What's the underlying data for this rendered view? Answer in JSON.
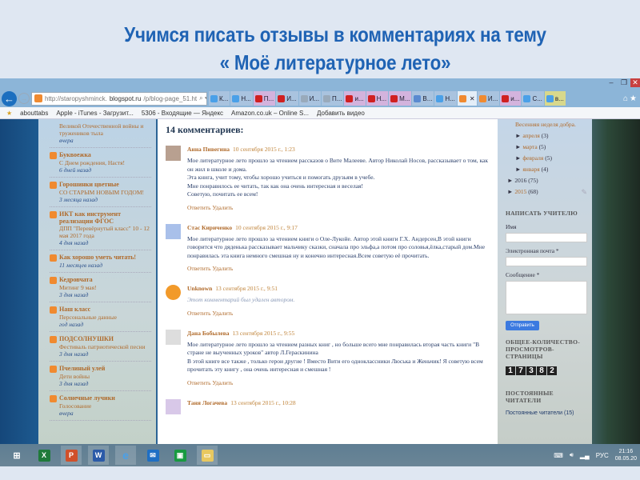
{
  "slide": {
    "title_line1": "Учимся писать отзывы в комментариях на тему",
    "title_line2": "« Моё литературное лето»"
  },
  "browser": {
    "url_host": "http://staropyshminck.",
    "url_domain": "blogspot.ru",
    "url_path": "/p/blog-page_51.ht",
    "tabs": [
      "К...",
      "Н...",
      "П...",
      "И...",
      "И...",
      "П...",
      "и...",
      "Н...",
      "М...",
      "В...",
      "Н...",
      "",
      "И...",
      "и...",
      "С...",
      "в..."
    ],
    "favorites": [
      "abouttabs",
      "Apple - iTunes - Загрузит...",
      "5306 - Входящие — Яндекс",
      "Amazon.co.uk – Online S...",
      "Добавить видео"
    ]
  },
  "left_sidebar": {
    "blogs": [
      {
        "name": "",
        "post": "Великой Отечественной войны и тружеников тыла",
        "when": "вчера"
      },
      {
        "name": "Буквоежка",
        "post": "С Днем рождения, Настя!",
        "when": "6 дней назад"
      },
      {
        "name": "Горошинки цветные",
        "post": "СО СТАРЫМ НОВЫМ ГОДОМ!",
        "when": "3 месяца назад"
      },
      {
        "name": "ИКТ как инструмент реализации ФГОС",
        "post": "ДПП \"Перевёрнутый класс\" 10 - 12 мая 2017 года",
        "when": "4 дня назад"
      },
      {
        "name": "Как хорошо уметь читать!",
        "post": "",
        "when": "11 месяцев назад"
      },
      {
        "name": "Кедровчата",
        "post": "Митинг 9 мая!",
        "when": "3 дня назад"
      },
      {
        "name": "Наш класс",
        "post": "Персональные данные",
        "when": "год назад"
      },
      {
        "name": "ПОДСОЛНУШКИ",
        "post": "Фестиваль патриотической песни",
        "when": "3 дня назад"
      },
      {
        "name": "Пчелиный улей",
        "post": "Дети войны",
        "when": "3 дня назад"
      },
      {
        "name": "Солнечные лучики",
        "post": "Голосование",
        "when": "вчера"
      }
    ]
  },
  "comments": {
    "count_label": "14 комментариев:",
    "reply": "Ответить",
    "delete": "Удалить",
    "items": [
      {
        "author": "Анна Пивегина",
        "date": "10 сентября 2015 г., 1:23",
        "text": "Мое литературное лето прошло за чтением рассказов о Вите Малееве. Автор Николай Носов, рассказывает о том, как он жил в школе и дома.\nЭта книга, учит тому, чтобы хорошо учиться и помогать друзьям в учебе.\nМне понравилось ее читать, так как она очень интересная и веселая!\nСоветую, почитать ее всем!"
      },
      {
        "author": "Стас Кириченко",
        "date": "10 сентября 2015 г., 9:17",
        "text": "Мое литературное лето прошло за чтением книги о Оле-Лукойе. Автор этой книги Г.Х. Андерсен,В этой книги говорится что дяденька рассказывает мальчику сказки, сначала про эльфа,а потом про соловья,ёлка,старый дом.Мне понравилась эта книга немного смешная ну и конечно интересная.Всем советую её прочитать."
      },
      {
        "author": "Unknown",
        "date": "13 сентября 2015 г., 9:51",
        "text": "Этот комментарий был удален автором."
      },
      {
        "author": "Дана Бобылева",
        "date": "13 сентября 2015 г., 9:55",
        "text": "Мое литературное лето прошло за чтением разных книг , но больше всего мне понравилась вторая часть книги \"В стране не выученных уроков\" автор Л.Гераскинина\nВ этой книге все также , только герои другие ! Вместо Вити его одноклассники Люська и Женьчик! Я советую всем прочитать эту книгу , она очень интересная и смешная !"
      },
      {
        "author": "Таня Логачева",
        "date": "13 сентября 2015 г., 10:28",
        "text": ""
      }
    ]
  },
  "right_sidebar": {
    "top_post": "Весенняя неделя добра.",
    "months": [
      {
        "m": "апреля",
        "c": "(3)"
      },
      {
        "m": "марта",
        "c": "(5)"
      },
      {
        "m": "февраля",
        "c": "(5)"
      },
      {
        "m": "января",
        "c": "(4)"
      }
    ],
    "years": [
      {
        "y": "2016",
        "c": "(75)"
      },
      {
        "y": "2015",
        "c": "(68)"
      }
    ],
    "contact_title": "НАПИСАТЬ УЧИТЕЛЮ",
    "name_label": "Имя",
    "email_label": "Электронная почта *",
    "message_label": "Сообщение *",
    "send": "Отправить",
    "views_title": "ОБЩЕЕ-КОЛИЧЕСТВО-ПРОСМОТРОВ-СТРАНИЦЫ",
    "views": [
      "1",
      "7",
      "3",
      "8",
      "2"
    ],
    "followers_title": "ПОСТОЯННЫЕ ЧИТАТЕЛИ",
    "followers": "Постоянные читатели (15)"
  },
  "taskbar": {
    "lang": "РУС",
    "time": "21:16",
    "date": "08.05.20"
  }
}
